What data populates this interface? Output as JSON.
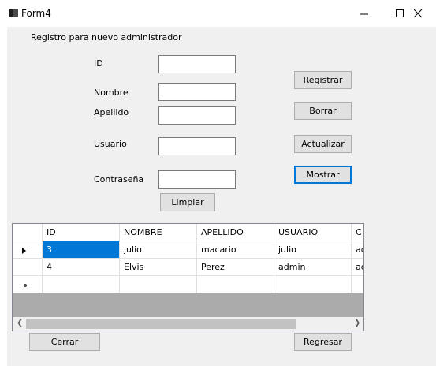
{
  "window": {
    "title": "Form4"
  },
  "form": {
    "heading": "Registro para nuevo administrador",
    "labels": {
      "id": "ID",
      "nombre": "Nombre",
      "apellido": "Apellido",
      "usuario": "Usuario",
      "contrasena": "Contraseña"
    },
    "fields": {
      "id": "",
      "nombre": "",
      "apellido": "",
      "usuario": "",
      "contrasena": ""
    },
    "buttons": {
      "registrar": "Registrar",
      "borrar": "Borrar",
      "actualizar": "Actualizar",
      "mostrar": "Mostrar",
      "limpiar": "Limpiar",
      "cerrar": "Cerrar",
      "regresar": "Regresar"
    }
  },
  "grid": {
    "columns": [
      "ID",
      "NOMBRE",
      "APELLIDO",
      "USUARIO",
      "C"
    ],
    "rows": [
      [
        "3",
        "julio",
        "macario",
        "julio",
        "ad"
      ],
      [
        "4",
        "Elvis",
        "Perez",
        "admin",
        "ad"
      ]
    ]
  }
}
